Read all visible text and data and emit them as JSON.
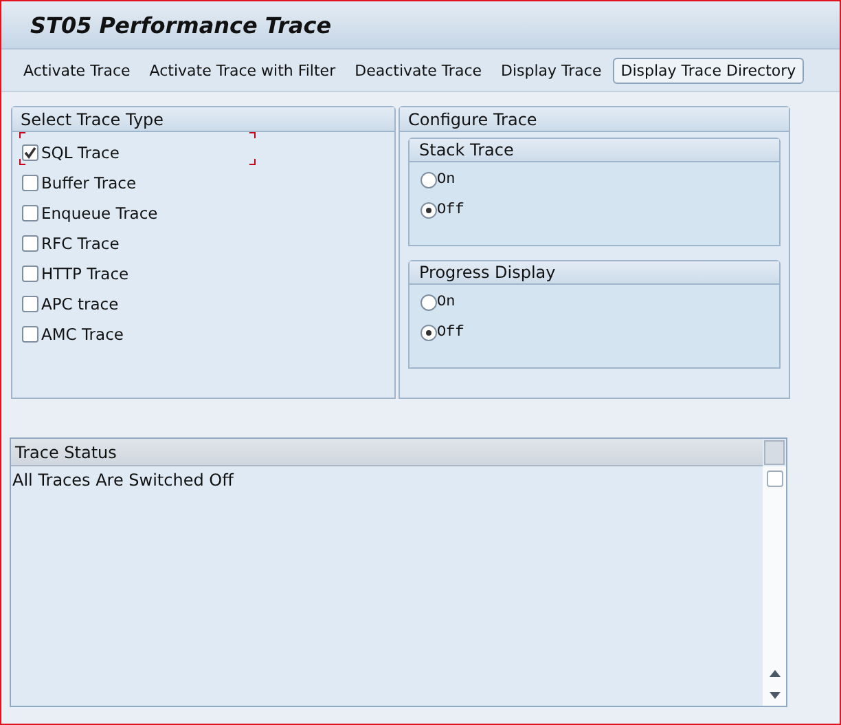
{
  "window": {
    "title": "ST05 Performance Trace"
  },
  "toolbar": [
    {
      "label": "Activate Trace",
      "kind": "plain"
    },
    {
      "label": "Activate Trace with Filter",
      "kind": "plain"
    },
    {
      "label": "Deactivate Trace",
      "kind": "plain"
    },
    {
      "label": "Display Trace",
      "kind": "plain"
    },
    {
      "label": "Display Trace Directory",
      "kind": "framed"
    }
  ],
  "select_trace_type": {
    "title": "Select Trace Type",
    "options": [
      {
        "label": "SQL Trace",
        "checked": true,
        "focused": true
      },
      {
        "label": "Buffer Trace",
        "checked": false,
        "focused": false
      },
      {
        "label": "Enqueue Trace",
        "checked": false,
        "focused": false
      },
      {
        "label": "RFC Trace",
        "checked": false,
        "focused": false
      },
      {
        "label": "HTTP Trace",
        "checked": false,
        "focused": false
      },
      {
        "label": "APC trace",
        "checked": false,
        "focused": false
      },
      {
        "label": "AMC Trace",
        "checked": false,
        "focused": false
      }
    ]
  },
  "configure_trace": {
    "title": "Configure Trace",
    "groups": [
      {
        "title": "Stack Trace",
        "options": [
          {
            "label": "On",
            "selected": false
          },
          {
            "label": "Off",
            "selected": true
          }
        ]
      },
      {
        "title": "Progress Display",
        "options": [
          {
            "label": "On",
            "selected": false
          },
          {
            "label": "Off",
            "selected": true
          }
        ]
      }
    ]
  },
  "trace_status": {
    "title": "Trace Status",
    "lines": [
      "All Traces Are Switched Off"
    ]
  }
}
